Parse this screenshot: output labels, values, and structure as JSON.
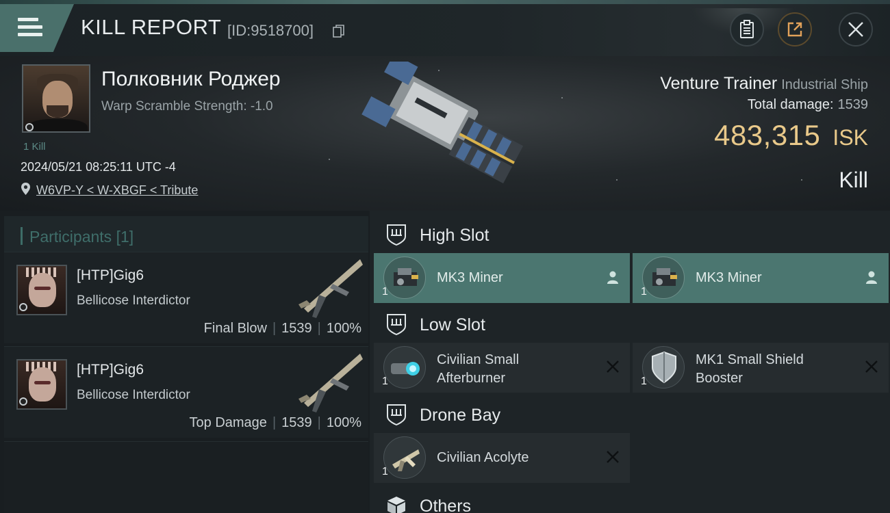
{
  "header": {
    "title": "KILL REPORT",
    "report_id": "[ID:9518700]"
  },
  "victim": {
    "name": "Полковник Роджер",
    "warp_scramble": "Warp Scramble Strength: -1.0",
    "kills": "1 Kill",
    "datetime": "2024/05/21 08:25:11 UTC -4",
    "location": "W6VP-Y < W-XBGF < Tribute"
  },
  "ship": {
    "name": "Venture Trainer",
    "class": "Industrial Ship",
    "total_damage_label": "Total damage:",
    "total_damage": "1539",
    "isk_value": "483,315",
    "isk_unit": "ISK",
    "result": "Kill"
  },
  "participants": {
    "title": "Participants",
    "count": "[1]",
    "items": [
      {
        "name": "[HTP]Gig6",
        "ship": "Bellicose Interdictor",
        "role": "Final Blow",
        "damage": "1539",
        "percent": "100%"
      },
      {
        "name": "[HTP]Gig6",
        "ship": "Bellicose Interdictor",
        "role": "Top Damage",
        "damage": "1539",
        "percent": "100%"
      }
    ]
  },
  "slots": {
    "high": {
      "label": "High Slot",
      "items": [
        {
          "name": "MK3 Miner",
          "qty": "1"
        },
        {
          "name": "MK3 Miner",
          "qty": "1"
        }
      ]
    },
    "low": {
      "label": "Low Slot",
      "items": [
        {
          "name_line1": "Civilian Small",
          "name_line2": "Afterburner",
          "qty": "1"
        },
        {
          "name_line1": "MK1 Small Shield",
          "name_line2": "Booster",
          "qty": "1"
        }
      ]
    },
    "drone": {
      "label": "Drone Bay",
      "items": [
        {
          "name": "Civilian Acolyte",
          "qty": "1"
        }
      ]
    },
    "others": {
      "label": "Others"
    }
  },
  "colors": {
    "accent": "#4b7670",
    "isk": "#e9c98a",
    "panel": "#1e2427"
  },
  "icons": [
    "menu-icon",
    "copy-icon",
    "clipboard-icon",
    "share-icon",
    "close-icon",
    "location-pin-icon",
    "slot-shield-icon",
    "person-icon",
    "dropped-x-icon",
    "cube-icon"
  ]
}
